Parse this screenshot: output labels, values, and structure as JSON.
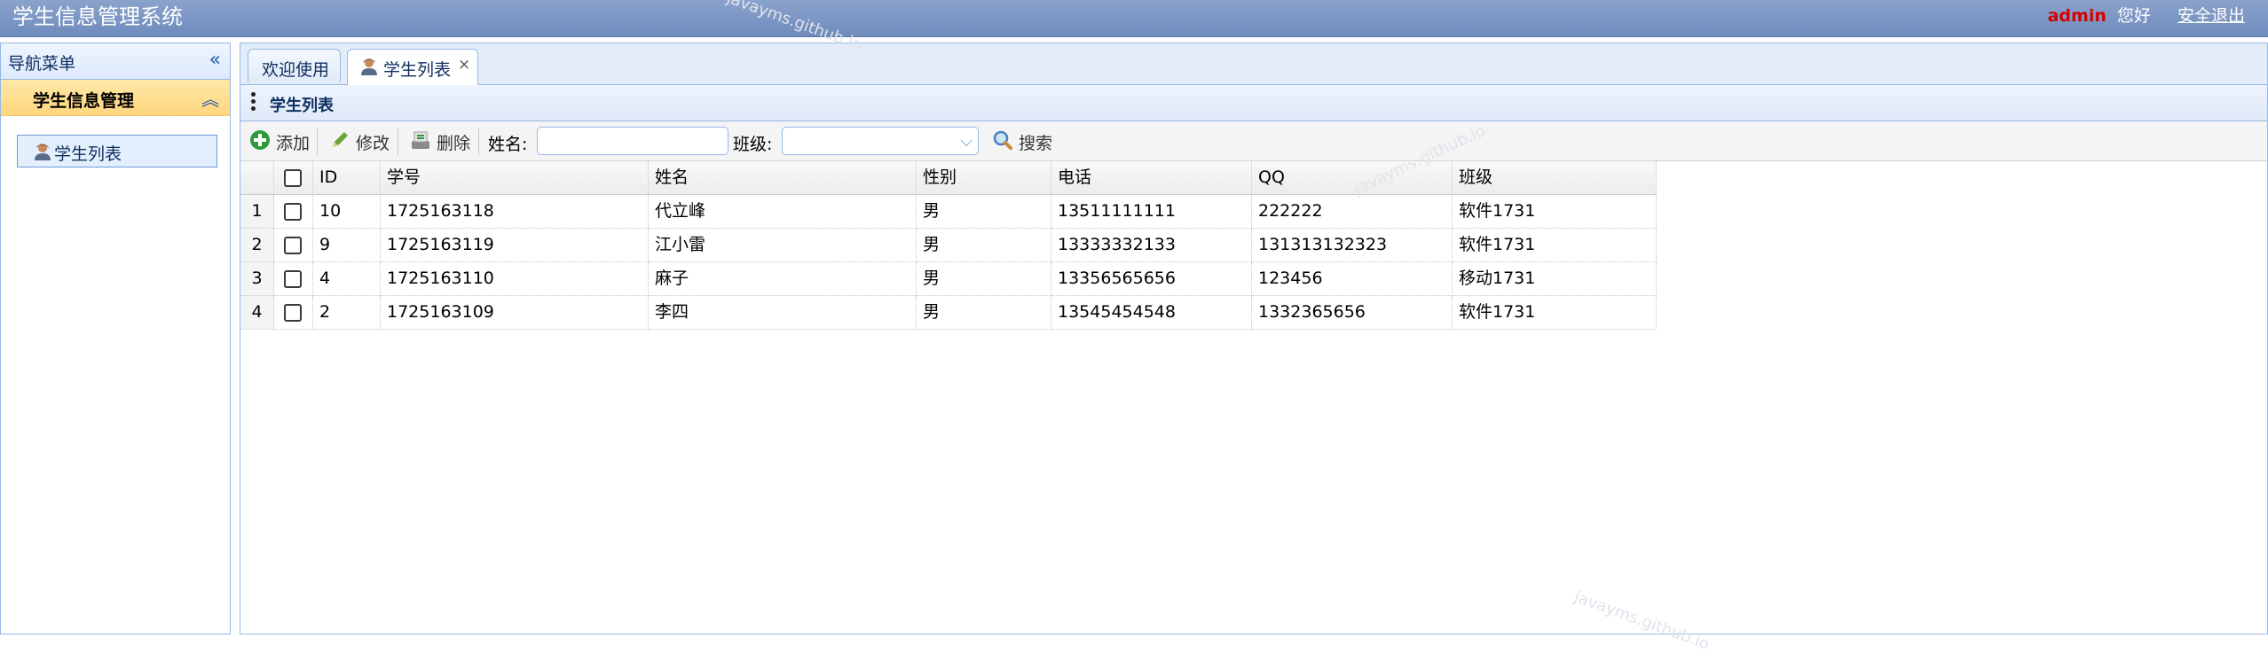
{
  "header": {
    "title": "学生信息管理系统",
    "user": "admin",
    "greeting": "您好",
    "logout": "安全退出"
  },
  "nav": {
    "title": "导航菜单",
    "collapse_icon": "double-chevron-left-icon",
    "group": "学生信息管理",
    "group_icon": "double-chevron-up-icon",
    "items": [
      {
        "label": "学生列表",
        "icon": "user-icon"
      }
    ]
  },
  "tabs": [
    {
      "label": "欢迎使用",
      "closable": false
    },
    {
      "label": "学生列表",
      "closable": true,
      "icon": "user-icon",
      "close": "×"
    }
  ],
  "panel": {
    "title": "学生列表"
  },
  "toolbar": {
    "add": "添加",
    "edit": "修改",
    "delete": "删除",
    "name_label": "姓名:",
    "name_value": "",
    "class_label": "班级:",
    "class_value": "",
    "search": "搜索"
  },
  "grid": {
    "columns": [
      "ID",
      "学号",
      "姓名",
      "性别",
      "电话",
      "QQ",
      "班级"
    ],
    "rows": [
      {
        "n": "1",
        "id": "10",
        "sno": "1725163118",
        "name": "代立峰",
        "sex": "男",
        "phone": "13511111111",
        "qq": "222222",
        "cls": "软件1731"
      },
      {
        "n": "2",
        "id": "9",
        "sno": "1725163119",
        "name": "江小雷",
        "sex": "男",
        "phone": "13333332133",
        "qq": "131313132323",
        "cls": "软件1731"
      },
      {
        "n": "3",
        "id": "4",
        "sno": "1725163110",
        "name": "麻子",
        "sex": "男",
        "phone": "13356565656",
        "qq": "123456",
        "cls": "移动1731"
      },
      {
        "n": "4",
        "id": "2",
        "sno": "1725163109",
        "name": "李四",
        "sex": "男",
        "phone": "13545454548",
        "qq": "1332365656",
        "cls": "软件1731"
      }
    ]
  },
  "watermark": "javayms.github.io"
}
